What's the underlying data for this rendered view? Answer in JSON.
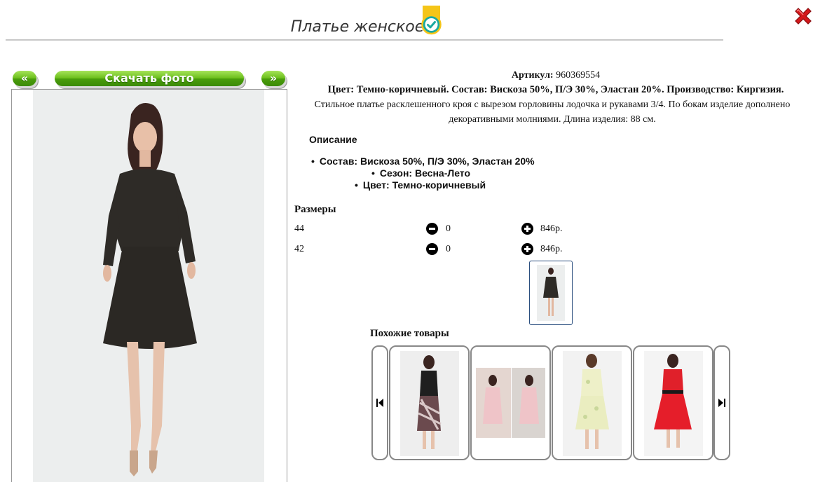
{
  "header": {
    "title": "Платье женское",
    "badge_icon": "verified-check-icon",
    "close_icon": "close-x-icon"
  },
  "gallery": {
    "prev_label": "«",
    "download_label": "Скачать фото",
    "next_label": "»"
  },
  "product": {
    "article_label": "Артикул:",
    "article_value": "960369554",
    "composition_line": "Цвет: Темно-коричневый. Состав: Вискоза 50%, П/Э 30%, Эластан 20%. Производство: Киргизия.",
    "description_text": "Стильное платье расклешенного кроя с вырезом горловины лодочка и рукавами 3/4. По бокам изделие дополнено декоративными молниями. Длина изделия: 88 см."
  },
  "description": {
    "label": "Описание",
    "items": [
      "Состав: Вискоза 50%, П/Э 30%, Эластан 20%",
      "Сезон: Весна-Лето",
      "Цвет: Темно-коричневый"
    ]
  },
  "sizes": {
    "label": "Размеры",
    "rows": [
      {
        "size": "44",
        "qty": "0",
        "price": "846р."
      },
      {
        "size": "42",
        "qty": "0",
        "price": "846р."
      }
    ]
  },
  "similar": {
    "label": "Похожие товары"
  },
  "colors": {
    "accent_green": "#6cbf1c",
    "close_red": "#d4181b",
    "badge_teal": "#1aa9a0",
    "badge_yellow": "#f5c518"
  }
}
